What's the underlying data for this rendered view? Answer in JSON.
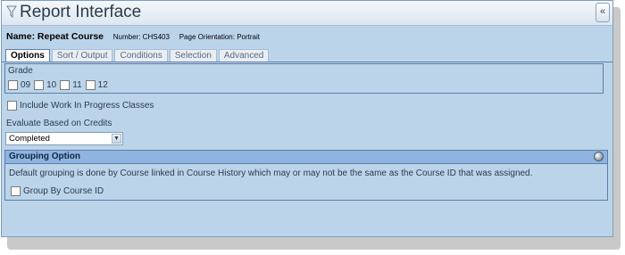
{
  "window": {
    "title": "Report Interface",
    "collapse_glyph": "«"
  },
  "report": {
    "name_label": "Name:",
    "name_value": "Repeat Course",
    "number": "Number: CHS403",
    "orientation": "Page Orientation: Portrait"
  },
  "tabs": [
    {
      "label": "Options",
      "active": true
    },
    {
      "label": "Sort / Output",
      "active": false
    },
    {
      "label": "Conditions",
      "active": false
    },
    {
      "label": "Selection",
      "active": false
    },
    {
      "label": "Advanced",
      "active": false
    }
  ],
  "grade": {
    "label": "Grade",
    "options": [
      {
        "label": "09",
        "checked": false
      },
      {
        "label": "10",
        "checked": false
      },
      {
        "label": "11",
        "checked": false
      },
      {
        "label": "12",
        "checked": false
      }
    ]
  },
  "work_in_progress": {
    "label": "Include Work In Progress Classes",
    "checked": false
  },
  "evaluate": {
    "label": "Evaluate Based on Credits",
    "selected": "Completed",
    "dropdown_glyph": "▼"
  },
  "grouping": {
    "title": "Grouping Option",
    "description": "Default grouping is done by Course linked in Course History which may or may not be the same as the Course ID that was assigned.",
    "checkbox_label": "Group By Course ID",
    "checked": false
  },
  "icons": [
    "funnel-icon",
    "collapse-icon",
    "circle-toggle-icon",
    "chevron-down-icon"
  ],
  "colors": {
    "panel": "#bcd4ea",
    "header": "#8fb4e0",
    "border": "#5b7fa6"
  }
}
